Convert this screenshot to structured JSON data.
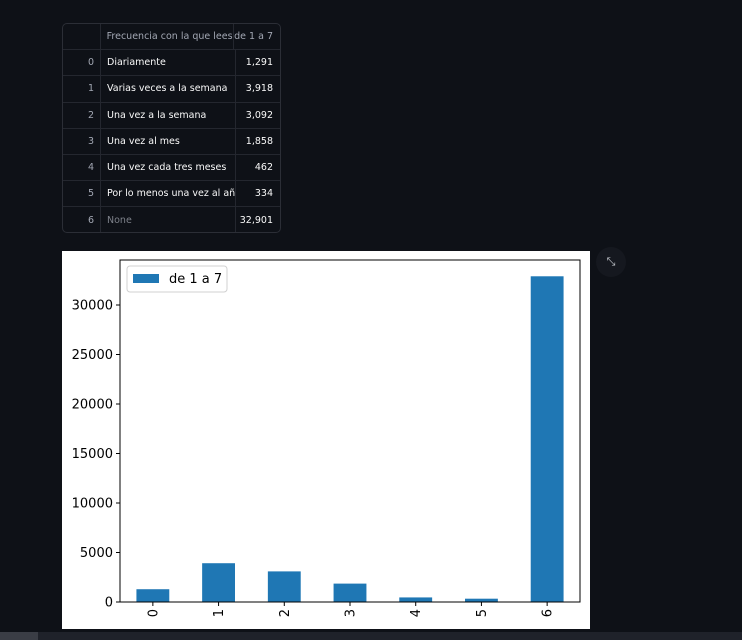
{
  "table": {
    "columns": [
      "",
      "Frecuencia con la que lees",
      "de 1 a 7"
    ],
    "rows": [
      {
        "index": "0",
        "label": "Diariamente",
        "value": "1,291"
      },
      {
        "index": "1",
        "label": "Varias veces a la semana",
        "value": "3,918"
      },
      {
        "index": "2",
        "label": "Una vez a la semana",
        "value": "3,092"
      },
      {
        "index": "3",
        "label": "Una vez al mes",
        "value": "1,858"
      },
      {
        "index": "4",
        "label": "Una vez cada tres meses",
        "value": "462"
      },
      {
        "index": "5",
        "label": "Por lo menos una vez al año",
        "value": "334"
      },
      {
        "index": "6",
        "label": "None",
        "value": "32,901"
      }
    ]
  },
  "expand_icon": "expand-icon",
  "colors": {
    "background": "#0e1117",
    "bar": "#1f77b4"
  },
  "chart_data": {
    "type": "bar",
    "categories": [
      "0",
      "1",
      "2",
      "3",
      "4",
      "5",
      "6"
    ],
    "series": [
      {
        "name": "de 1 a 7",
        "values": [
          1291,
          3918,
          3092,
          1858,
          462,
          334,
          32901
        ]
      }
    ],
    "ylim": [
      0,
      34546
    ],
    "yticks": [
      0,
      5000,
      10000,
      15000,
      20000,
      25000,
      30000
    ],
    "xlabel": "",
    "ylabel": "",
    "legend": "top-left",
    "grid": false
  }
}
